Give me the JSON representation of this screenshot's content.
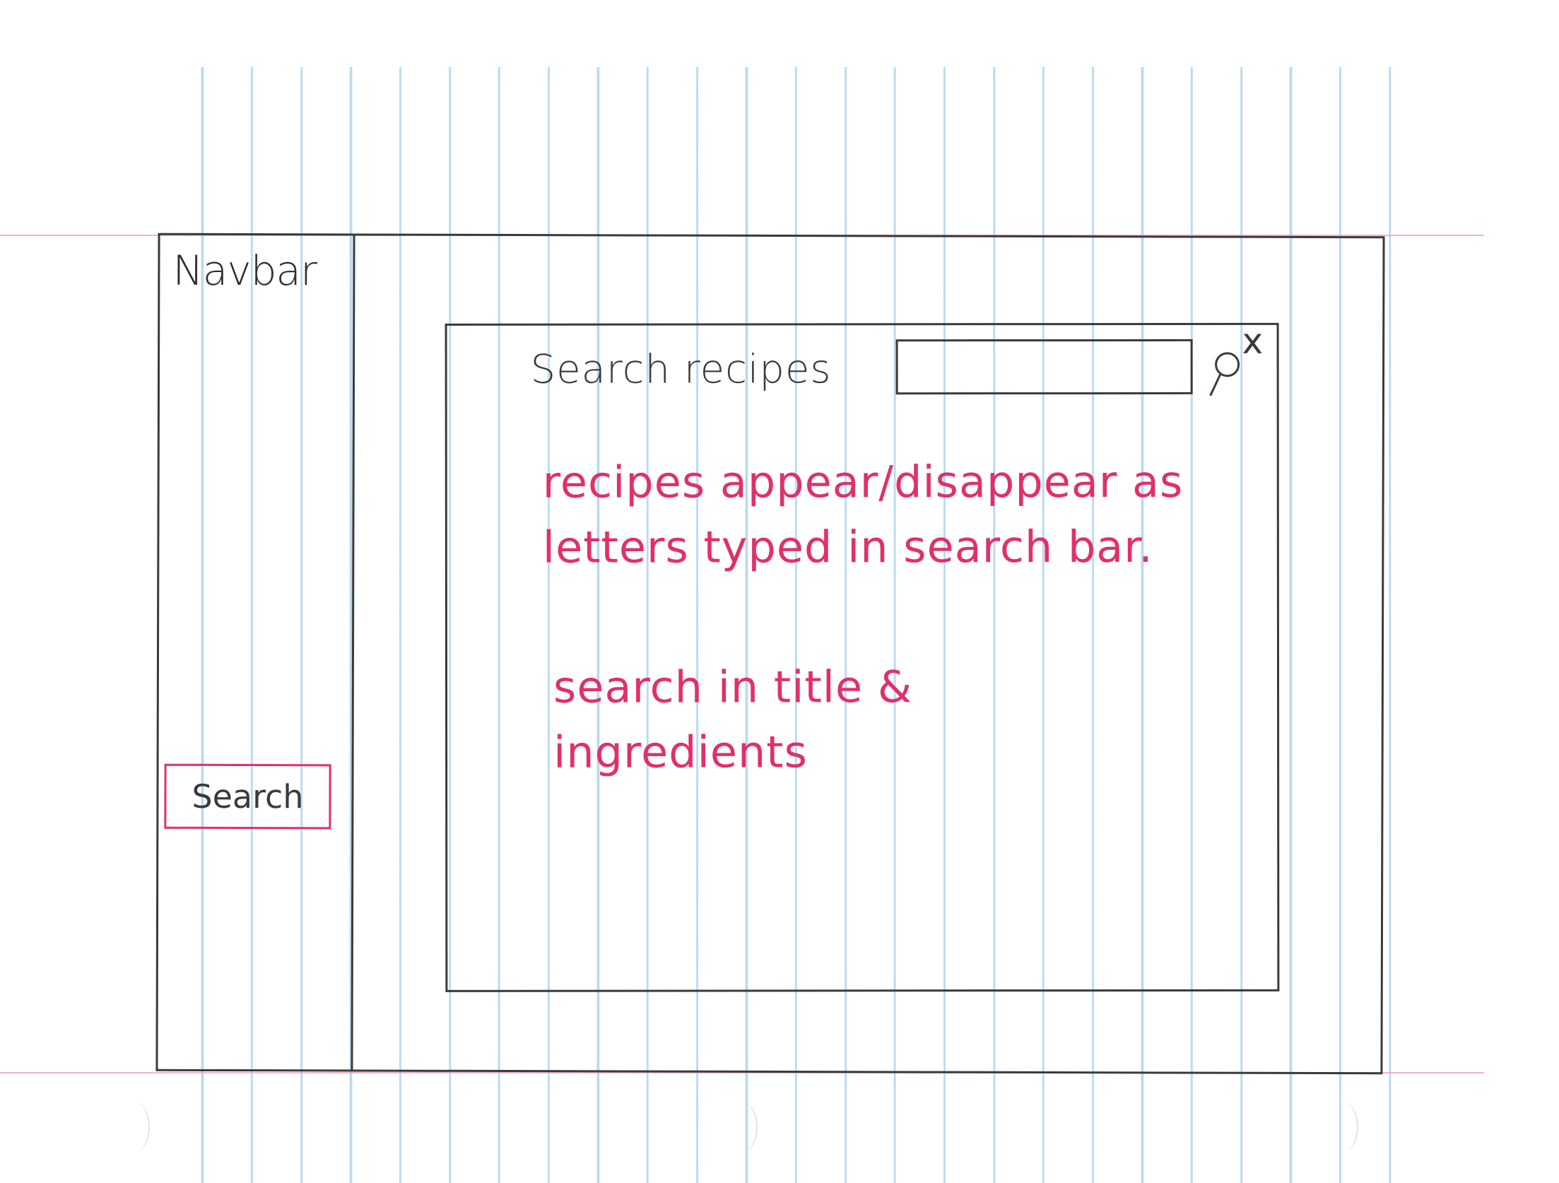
{
  "navbar": {
    "title": "Navbar",
    "search_button_label": "Search"
  },
  "search_modal": {
    "label": "Search recipes",
    "input_value": "",
    "close_label": "x"
  },
  "notes": [
    "recipes appear/disappear as letters typed in search bar.",
    "search in title & ingredients"
  ],
  "colors": {
    "ink": "#3a3a3a",
    "annotation": "#e0306a",
    "ruled_line": "#a0cdeb",
    "margin_line": "#f096aa"
  }
}
